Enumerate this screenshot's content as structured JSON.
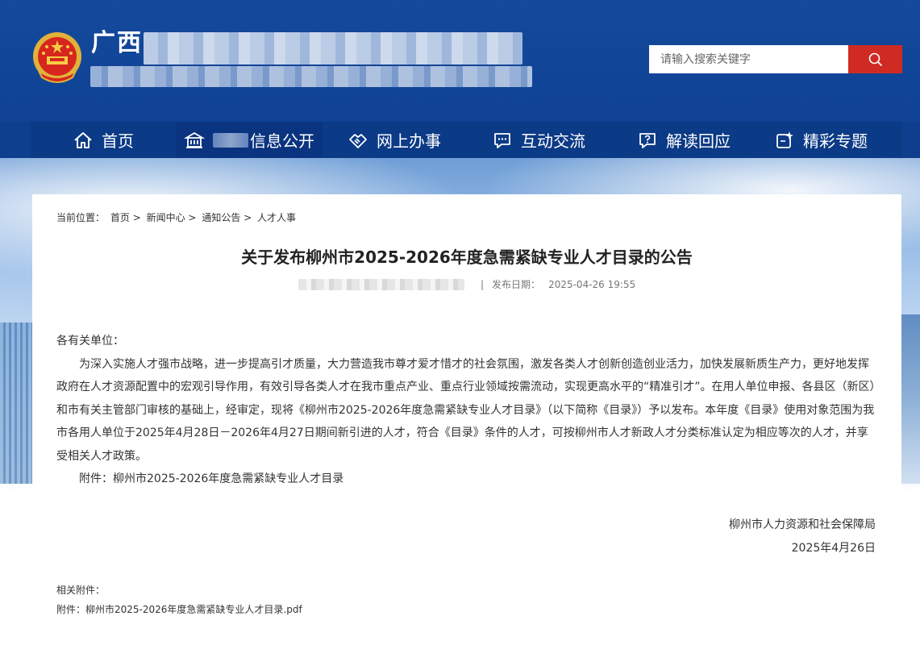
{
  "header": {
    "site_title": "广西",
    "search": {
      "placeholder": "请输入搜索关键字"
    }
  },
  "nav": {
    "items": [
      {
        "label": "首页",
        "icon": "home-icon"
      },
      {
        "label": "信息公开",
        "icon": "building-icon"
      },
      {
        "label": "网上办事",
        "icon": "handshake-icon"
      },
      {
        "label": "互动交流",
        "icon": "chat-icon"
      },
      {
        "label": "解读回应",
        "icon": "question-chat-icon"
      },
      {
        "label": "精彩专题",
        "icon": "sparkle-icon"
      }
    ]
  },
  "breadcrumb": {
    "prefix": "当前位置：",
    "items": [
      "首页",
      "新闻中心",
      "通知公告",
      "人才人事"
    ],
    "separator": ">"
  },
  "article": {
    "title": "关于发布柳州市2025-2026年度急需紧缺专业人才目录的公告",
    "date_label": "发布日期：",
    "date": "2025-04-26 19:55",
    "salutation": "各有关单位：",
    "paragraph": "为深入实施人才强市战略，进一步提高引才质量，大力营造我市尊才爱才惜才的社会氛围，激发各类人才创新创造创业活力，加快发展新质生产力，更好地发挥政府在人才资源配置中的宏观引导作用，有效引导各类人才在我市重点产业、重点行业领域按需流动，实现更高水平的“精准引才”。在用人单位申报、各县区（新区）和市有关主管部门审核的基础上，经审定，现将《柳州市2025-2026年度急需紧缺专业人才目录》（以下简称《目录》）予以发布。本年度《目录》使用对象范围为我市各用人单位于2025年4月28日－2026年4月27日期间新引进的人才，符合《目录》条件的人才，可按柳州市人才新政人才分类标准认定为相应等次的人才，并享受相关人才政策。",
    "attachment_line": "附件：柳州市2025-2026年度急需紧缺专业人才目录",
    "signature_org": "柳州市人力资源和社会保障局",
    "signature_date": "2025年4月26日",
    "related_label": "相关附件：",
    "related_file": "附件：柳州市2025-2026年度急需紧缺专业人才目录.pdf"
  },
  "colors": {
    "header_blue": "#14499b",
    "nav_blue": "#0b3a86",
    "search_red": "#cf2b22"
  }
}
